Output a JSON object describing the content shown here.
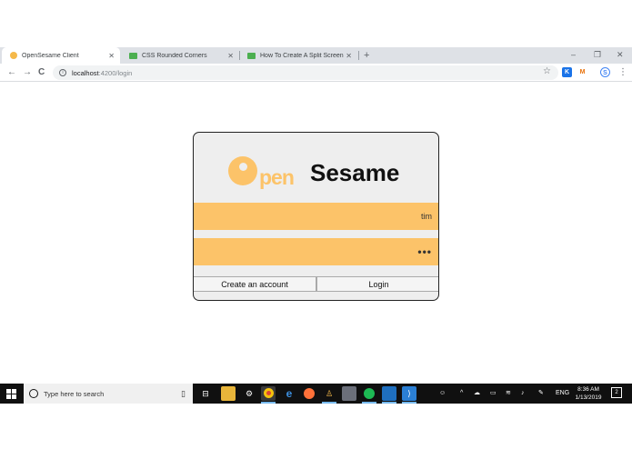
{
  "browser": {
    "tabs": [
      {
        "title": "OpenSesame Client",
        "active": true
      },
      {
        "title": "CSS Rounded Corners",
        "active": false
      },
      {
        "title": "How To Create A Split Screen",
        "active": false
      }
    ],
    "new_tab": "+",
    "close_glyph": "✕",
    "window_controls": {
      "minimize": "–",
      "restore": "❐",
      "close": "✕"
    },
    "nav": {
      "back": "←",
      "forward": "→",
      "reload": "C"
    },
    "address": {
      "host": "localhost",
      "path": ":4200/login",
      "info": "i"
    },
    "bookmark": "☆",
    "extensions": {
      "k": "K",
      "m": "M",
      "s": "S"
    },
    "menu": "⋮"
  },
  "login": {
    "logo_pen": "pen",
    "logo_sesame": "Sesame",
    "username_value": "tim",
    "password_value": "•••",
    "create_account_label": "Create an account",
    "login_label": "Login",
    "colors": {
      "accent": "#fcc369",
      "card_bg": "#eeeeee",
      "border": "#222222"
    }
  },
  "taskbar": {
    "search_placeholder": "Type here to search",
    "mic": "🎙",
    "apps": [
      "task-view-icon",
      "file-explorer-icon",
      "settings-icon",
      "chrome-icon",
      "edge-icon",
      "firefox-icon",
      "app-icon",
      "mail-icon",
      "spotify-icon",
      "store-icon",
      "vscode-icon"
    ],
    "tray": {
      "people": "☺",
      "chevron": "^",
      "lang": "ENG"
    },
    "time": "8:36 AM",
    "date": "1/13/2019",
    "notifications": "2"
  }
}
